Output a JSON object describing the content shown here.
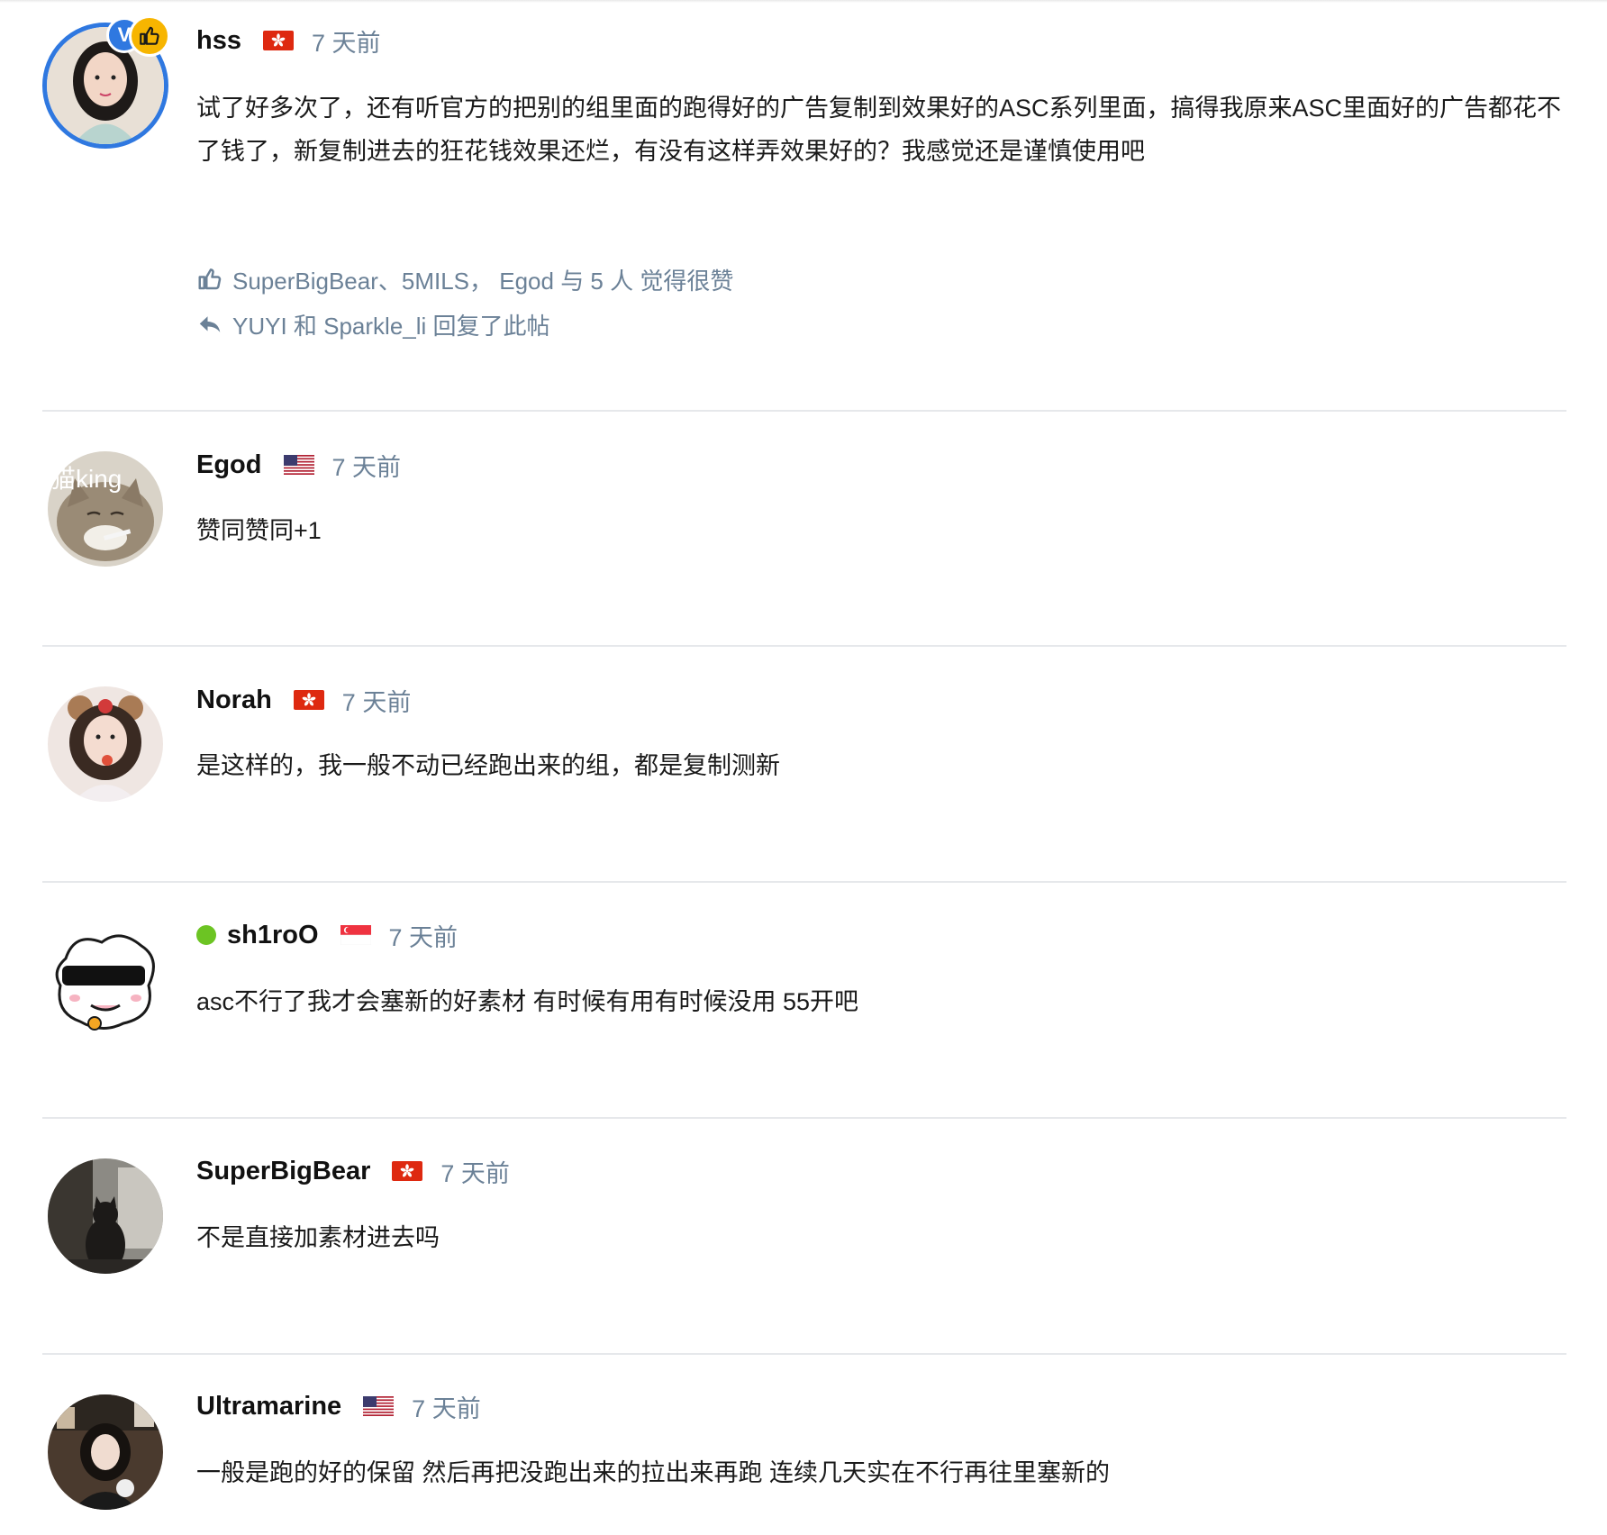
{
  "posts": [
    {
      "username": "hss",
      "flag": "hk",
      "time": "7 天前",
      "content": "试了好多次了，还有听官方的把别的组里面的跑得好的广告复制到效果好的ASC系列里面，搞得我原来ASC里面好的广告都花不了钱了，新复制进去的狂花钱效果还烂，有没有这样弄效果好的？我感觉还是谨慎使用吧",
      "likes_text": "SuperBigBear、5MILS， Egod 与 5 人 觉得很赞",
      "replies_text": "YUYI 和 Sparkle_li 回复了此帖",
      "badge_letter": "V"
    },
    {
      "username": "Egod",
      "flag": "us",
      "time": "7 天前",
      "content": "赞同赞同+1",
      "avatar_text": "猫king"
    },
    {
      "username": "Norah",
      "flag": "hk",
      "time": "7 天前",
      "content": "是这样的，我一般不动已经跑出来的组，都是复制测新"
    },
    {
      "username": "sh1roO",
      "flag": "sg",
      "time": "7 天前",
      "content": "asc不行了我才会塞新的好素材 有时候有用有时候没用 55开吧",
      "online": true
    },
    {
      "username": "SuperBigBear",
      "flag": "hk",
      "time": "7 天前",
      "content": "不是直接加素材进去吗"
    },
    {
      "username": "Ultramarine",
      "flag": "us",
      "time": "7 天前",
      "content": "一般是跑的好的保留 然后再把没跑出来的拉出来再跑 连续几天实在不行再往里塞新的"
    }
  ],
  "colors": {
    "accent": "#2f78e0",
    "meta": "#6b8197",
    "online": "#6cc423",
    "badge": "#f7b500"
  },
  "icons": {
    "like": "thumbs-up-icon",
    "reply": "reply-icon"
  }
}
